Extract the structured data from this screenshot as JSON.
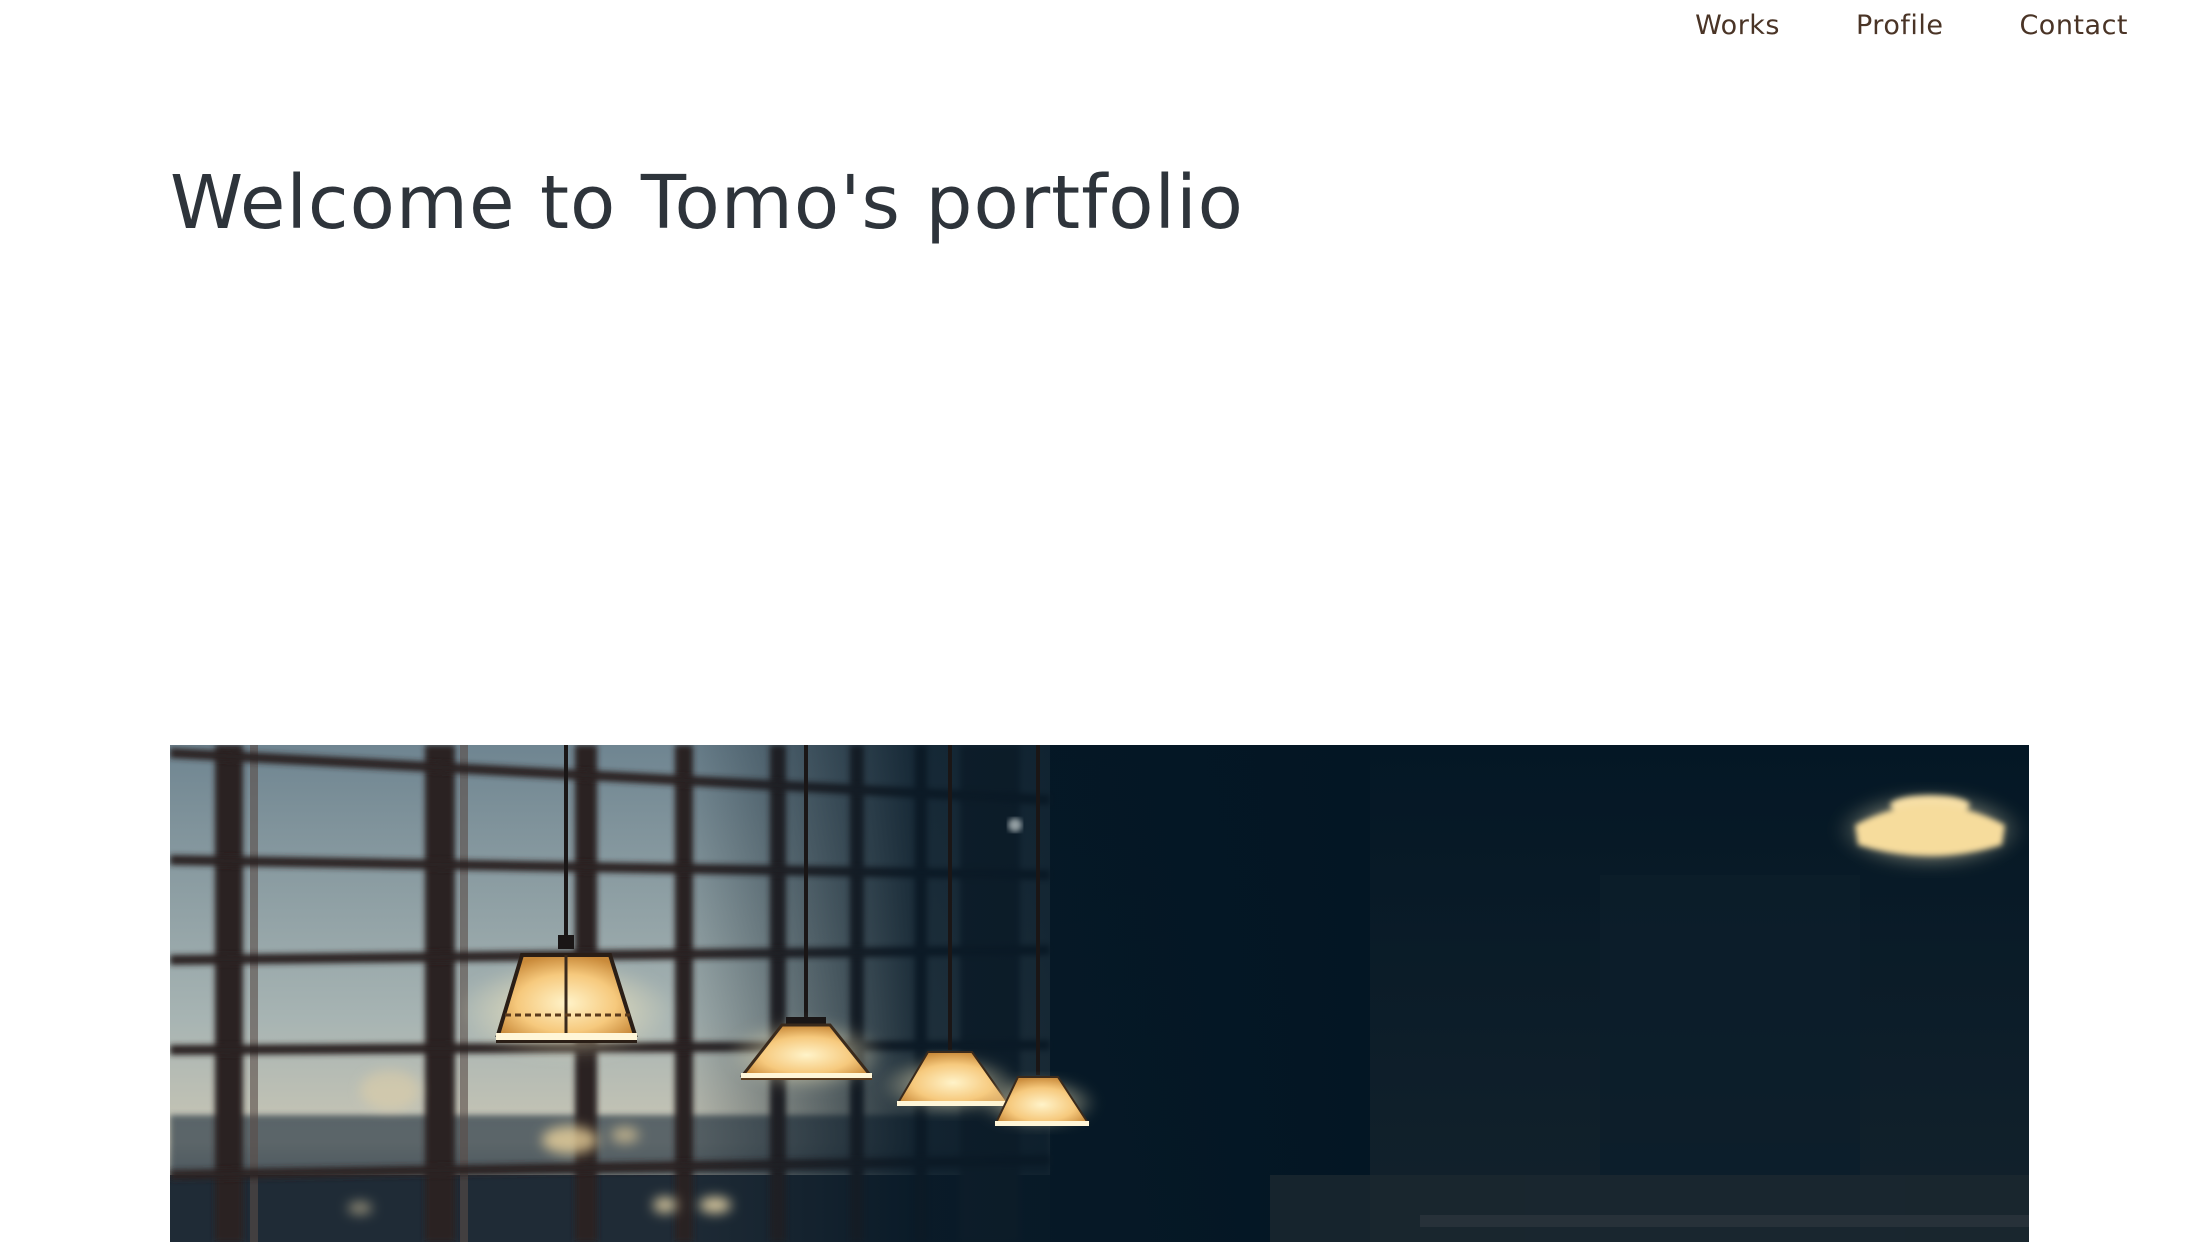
{
  "nav": {
    "items": [
      {
        "label": "Works"
      },
      {
        "label": "Profile"
      },
      {
        "label": "Contact"
      }
    ]
  },
  "hero": {
    "title": "Welcome to Tomo's portfolio",
    "image_alt": "cafe-pendant-lamps-photo"
  },
  "colors": {
    "nav_text": "#4a3426",
    "title_text": "#2e343b",
    "background": "#ffffff"
  }
}
